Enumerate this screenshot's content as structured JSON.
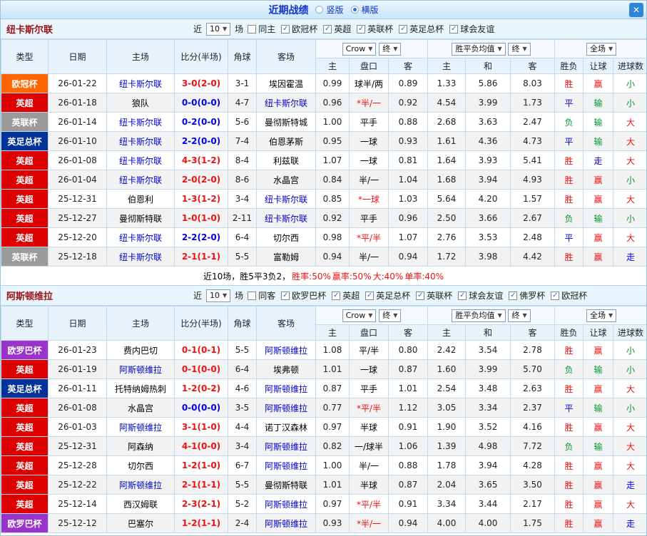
{
  "header": {
    "title": "近期战绩",
    "view_options": [
      {
        "label": "竖版",
        "selected": false
      },
      {
        "label": "横版",
        "selected": true
      }
    ],
    "close_label": "✕"
  },
  "palette": {
    "win": "#ee1111",
    "loss": "#009933",
    "draw": "#0000ee",
    "push": "#0000ee",
    "focus_team": "#0000cc",
    "score_red": "#ee1111",
    "score_blue": "#0000ee"
  },
  "columns": [
    "类型",
    "日期",
    "主场",
    "比分(半场)",
    "角球",
    "客场",
    "主",
    "盘口",
    "客",
    "主",
    "和",
    "客",
    "胜负",
    "让球",
    "进球数"
  ],
  "sections": [
    {
      "team": "纽卡斯尔联",
      "filter": {
        "near_label": "近",
        "count_value": "10",
        "games_label": "场",
        "checkboxes": [
          {
            "label": "同主",
            "checked": false
          },
          {
            "label": "欧冠杯",
            "checked": true
          },
          {
            "label": "英超",
            "checked": true
          },
          {
            "label": "英联杯",
            "checked": true
          },
          {
            "label": "英足总杯",
            "checked": true
          },
          {
            "label": "球会友谊",
            "checked": true
          }
        ]
      },
      "controls": {
        "odds_source": "Crow",
        "odds_time": "终",
        "europe_label": "胜平负均值",
        "europe_time": "终",
        "scope": "全场"
      },
      "rows": [
        {
          "league": "欧冠杯",
          "league_color": "#ff6600",
          "date": "26-01-22",
          "home": "纽卡斯尔联",
          "home_focus": true,
          "score": "3-0(2-0)",
          "score_color": "red",
          "corner": "3-1",
          "away": "埃因霍温",
          "away_focus": false,
          "ah_home": "0.99",
          "handicap": "球半/两",
          "handicap_star": false,
          "ah_away": "0.89",
          "o_home": "1.33",
          "o_draw": "5.86",
          "o_away": "8.03",
          "result": "胜",
          "handicap_result": "赢",
          "goals": "小"
        },
        {
          "league": "英超",
          "league_color": "#dd0000",
          "date": "26-01-18",
          "home": "狼队",
          "home_focus": false,
          "score": "0-0(0-0)",
          "score_color": "blue",
          "corner": "4-7",
          "away": "纽卡斯尔联",
          "away_focus": true,
          "ah_home": "0.96",
          "handicap": "*半/一",
          "handicap_star": true,
          "ah_away": "0.92",
          "o_home": "4.54",
          "o_draw": "3.99",
          "o_away": "1.73",
          "result": "平",
          "handicap_result": "输",
          "goals": "小"
        },
        {
          "league": "英联杯",
          "league_color": "#9a9a9a",
          "date": "26-01-14",
          "home": "纽卡斯尔联",
          "home_focus": true,
          "score": "0-2(0-0)",
          "score_color": "blue",
          "corner": "5-6",
          "away": "曼彻斯特城",
          "away_focus": false,
          "ah_home": "1.00",
          "handicap": "平手",
          "handicap_star": false,
          "ah_away": "0.88",
          "o_home": "2.68",
          "o_draw": "3.63",
          "o_away": "2.47",
          "result": "负",
          "handicap_result": "输",
          "goals": "大"
        },
        {
          "league": "英足总杯",
          "league_color": "#003399",
          "date": "26-01-10",
          "home": "纽卡斯尔联",
          "home_focus": true,
          "score": "2-2(0-0)",
          "score_color": "blue",
          "corner": "7-4",
          "away": "伯恩茅斯",
          "away_focus": false,
          "ah_home": "0.95",
          "handicap": "一球",
          "handicap_star": false,
          "ah_away": "0.93",
          "o_home": "1.61",
          "o_draw": "4.36",
          "o_away": "4.73",
          "result": "平",
          "handicap_result": "输",
          "goals": "大"
        },
        {
          "league": "英超",
          "league_color": "#dd0000",
          "date": "26-01-08",
          "home": "纽卡斯尔联",
          "home_focus": true,
          "score": "4-3(1-2)",
          "score_color": "red",
          "corner": "8-4",
          "away": "利兹联",
          "away_focus": false,
          "ah_home": "1.07",
          "handicap": "一球",
          "handicap_star": false,
          "ah_away": "0.81",
          "o_home": "1.64",
          "o_draw": "3.93",
          "o_away": "5.41",
          "result": "胜",
          "handicap_result": "走",
          "goals": "大"
        },
        {
          "league": "英超",
          "league_color": "#dd0000",
          "date": "26-01-04",
          "home": "纽卡斯尔联",
          "home_focus": true,
          "score": "2-0(2-0)",
          "score_color": "red",
          "corner": "8-6",
          "away": "水晶宫",
          "away_focus": false,
          "ah_home": "0.84",
          "handicap": "半/一",
          "handicap_star": false,
          "ah_away": "1.04",
          "o_home": "1.68",
          "o_draw": "3.94",
          "o_away": "4.93",
          "result": "胜",
          "handicap_result": "赢",
          "goals": "小"
        },
        {
          "league": "英超",
          "league_color": "#dd0000",
          "date": "25-12-31",
          "home": "伯恩利",
          "home_focus": false,
          "score": "1-3(1-2)",
          "score_color": "red",
          "corner": "3-4",
          "away": "纽卡斯尔联",
          "away_focus": true,
          "ah_home": "0.85",
          "handicap": "*一球",
          "handicap_star": true,
          "ah_away": "1.03",
          "o_home": "5.64",
          "o_draw": "4.20",
          "o_away": "1.57",
          "result": "胜",
          "handicap_result": "赢",
          "goals": "大"
        },
        {
          "league": "英超",
          "league_color": "#dd0000",
          "date": "25-12-27",
          "home": "曼彻斯特联",
          "home_focus": false,
          "score": "1-0(1-0)",
          "score_color": "red",
          "corner": "2-11",
          "away": "纽卡斯尔联",
          "away_focus": true,
          "ah_home": "0.92",
          "handicap": "平手",
          "handicap_star": false,
          "ah_away": "0.96",
          "o_home": "2.50",
          "o_draw": "3.66",
          "o_away": "2.67",
          "result": "负",
          "handicap_result": "输",
          "goals": "小"
        },
        {
          "league": "英超",
          "league_color": "#dd0000",
          "date": "25-12-20",
          "home": "纽卡斯尔联",
          "home_focus": true,
          "score": "2-2(2-0)",
          "score_color": "blue",
          "corner": "6-4",
          "away": "切尔西",
          "away_focus": false,
          "ah_home": "0.98",
          "handicap": "*平/半",
          "handicap_star": true,
          "ah_away": "1.07",
          "o_home": "2.76",
          "o_draw": "3.53",
          "o_away": "2.48",
          "result": "平",
          "handicap_result": "赢",
          "goals": "大"
        },
        {
          "league": "英联杯",
          "league_color": "#9a9a9a",
          "date": "25-12-18",
          "home": "纽卡斯尔联",
          "home_focus": true,
          "score": "2-1(1-1)",
          "score_color": "red",
          "corner": "5-5",
          "away": "富勒姆",
          "away_focus": false,
          "ah_home": "0.94",
          "handicap": "半/一",
          "handicap_star": false,
          "ah_away": "0.94",
          "o_home": "1.72",
          "o_draw": "3.98",
          "o_away": "4.42",
          "result": "胜",
          "handicap_result": "赢",
          "goals": "走"
        }
      ],
      "summary": [
        {
          "text": "近10场，胜5平3负2，",
          "color": "#000000"
        },
        {
          "text": "胜率:50%",
          "color": "#ee1111"
        },
        {
          "text": " 赢率:50%",
          "color": "#ee1111"
        },
        {
          "text": " 大:40%",
          "color": "#ee1111"
        },
        {
          "text": " 单率:40%",
          "color": "#ee1111"
        }
      ]
    },
    {
      "team": "阿斯顿维拉",
      "filter": {
        "near_label": "近",
        "count_value": "10",
        "games_label": "场",
        "checkboxes": [
          {
            "label": "同客",
            "checked": false
          },
          {
            "label": "欧罗巴杯",
            "checked": true
          },
          {
            "label": "英超",
            "checked": true
          },
          {
            "label": "英足总杯",
            "checked": true
          },
          {
            "label": "英联杯",
            "checked": true
          },
          {
            "label": "球会友谊",
            "checked": true
          },
          {
            "label": "佛罗杯",
            "checked": true
          },
          {
            "label": "欧冠杯",
            "checked": true
          }
        ]
      },
      "controls": {
        "odds_source": "Crow",
        "odds_time": "终",
        "europe_label": "胜平负均值",
        "europe_time": "终",
        "scope": "全场"
      },
      "rows": [
        {
          "league": "欧罗巴杯",
          "league_color": "#9933cc",
          "date": "26-01-23",
          "home": "费内巴切",
          "home_focus": false,
          "score": "0-1(0-1)",
          "score_color": "red",
          "corner": "5-5",
          "away": "阿斯顿维拉",
          "away_focus": true,
          "ah_home": "1.08",
          "handicap": "平/半",
          "handicap_star": false,
          "ah_away": "0.80",
          "o_home": "2.42",
          "o_draw": "3.54",
          "o_away": "2.78",
          "result": "胜",
          "handicap_result": "赢",
          "goals": "小"
        },
        {
          "league": "英超",
          "league_color": "#dd0000",
          "date": "26-01-19",
          "home": "阿斯顿维拉",
          "home_focus": true,
          "score": "0-1(0-0)",
          "score_color": "red",
          "corner": "6-4",
          "away": "埃弗顿",
          "away_focus": false,
          "ah_home": "1.01",
          "handicap": "一球",
          "handicap_star": false,
          "ah_away": "0.87",
          "o_home": "1.60",
          "o_draw": "3.99",
          "o_away": "5.70",
          "result": "负",
          "handicap_result": "输",
          "goals": "小"
        },
        {
          "league": "英足总杯",
          "league_color": "#003399",
          "date": "26-01-11",
          "home": "托特纳姆热刺",
          "home_focus": false,
          "score": "1-2(0-2)",
          "score_color": "red",
          "corner": "4-6",
          "away": "阿斯顿维拉",
          "away_focus": true,
          "ah_home": "0.87",
          "handicap": "平手",
          "handicap_star": false,
          "ah_away": "1.01",
          "o_home": "2.54",
          "o_draw": "3.48",
          "o_away": "2.63",
          "result": "胜",
          "handicap_result": "赢",
          "goals": "大"
        },
        {
          "league": "英超",
          "league_color": "#dd0000",
          "date": "26-01-08",
          "home": "水晶宫",
          "home_focus": false,
          "score": "0-0(0-0)",
          "score_color": "blue",
          "corner": "3-5",
          "away": "阿斯顿维拉",
          "away_focus": true,
          "ah_home": "0.77",
          "handicap": "*平/半",
          "handicap_star": true,
          "ah_away": "1.12",
          "o_home": "3.05",
          "o_draw": "3.34",
          "o_away": "2.37",
          "result": "平",
          "handicap_result": "输",
          "goals": "小"
        },
        {
          "league": "英超",
          "league_color": "#dd0000",
          "date": "26-01-03",
          "home": "阿斯顿维拉",
          "home_focus": true,
          "score": "3-1(1-0)",
          "score_color": "red",
          "corner": "4-4",
          "away": "诺丁汉森林",
          "away_focus": false,
          "ah_home": "0.97",
          "handicap": "半球",
          "handicap_star": false,
          "ah_away": "0.91",
          "o_home": "1.90",
          "o_draw": "3.52",
          "o_away": "4.16",
          "result": "胜",
          "handicap_result": "赢",
          "goals": "大"
        },
        {
          "league": "英超",
          "league_color": "#dd0000",
          "date": "25-12-31",
          "home": "阿森纳",
          "home_focus": false,
          "score": "4-1(0-0)",
          "score_color": "red",
          "corner": "3-4",
          "away": "阿斯顿维拉",
          "away_focus": true,
          "ah_home": "0.82",
          "handicap": "一/球半",
          "handicap_star": false,
          "ah_away": "1.06",
          "o_home": "1.39",
          "o_draw": "4.98",
          "o_away": "7.72",
          "result": "负",
          "handicap_result": "输",
          "goals": "大"
        },
        {
          "league": "英超",
          "league_color": "#dd0000",
          "date": "25-12-28",
          "home": "切尔西",
          "home_focus": false,
          "score": "1-2(1-0)",
          "score_color": "red",
          "corner": "6-7",
          "away": "阿斯顿维拉",
          "away_focus": true,
          "ah_home": "1.00",
          "handicap": "半/一",
          "handicap_star": false,
          "ah_away": "0.88",
          "o_home": "1.78",
          "o_draw": "3.94",
          "o_away": "4.28",
          "result": "胜",
          "handicap_result": "赢",
          "goals": "大"
        },
        {
          "league": "英超",
          "league_color": "#dd0000",
          "date": "25-12-22",
          "home": "阿斯顿维拉",
          "home_focus": true,
          "score": "2-1(1-1)",
          "score_color": "red",
          "corner": "5-5",
          "away": "曼彻斯特联",
          "away_focus": false,
          "ah_home": "1.01",
          "handicap": "半球",
          "handicap_star": false,
          "ah_away": "0.87",
          "o_home": "2.04",
          "o_draw": "3.65",
          "o_away": "3.50",
          "result": "胜",
          "handicap_result": "赢",
          "goals": "走"
        },
        {
          "league": "英超",
          "league_color": "#dd0000",
          "date": "25-12-14",
          "home": "西汉姆联",
          "home_focus": false,
          "score": "2-3(2-1)",
          "score_color": "red",
          "corner": "5-2",
          "away": "阿斯顿维拉",
          "away_focus": true,
          "ah_home": "0.97",
          "handicap": "*平/半",
          "handicap_star": true,
          "ah_away": "0.91",
          "o_home": "3.34",
          "o_draw": "3.44",
          "o_away": "2.17",
          "result": "胜",
          "handicap_result": "赢",
          "goals": "大"
        },
        {
          "league": "欧罗巴杯",
          "league_color": "#9933cc",
          "date": "25-12-12",
          "home": "巴塞尔",
          "home_focus": false,
          "score": "1-2(1-1)",
          "score_color": "red",
          "corner": "2-4",
          "away": "阿斯顿维拉",
          "away_focus": true,
          "ah_home": "0.93",
          "handicap": "*半/一",
          "handicap_star": true,
          "ah_away": "0.94",
          "o_home": "4.00",
          "o_draw": "4.00",
          "o_away": "1.75",
          "result": "胜",
          "handicap_result": "赢",
          "goals": "走"
        }
      ],
      "summary": []
    }
  ]
}
